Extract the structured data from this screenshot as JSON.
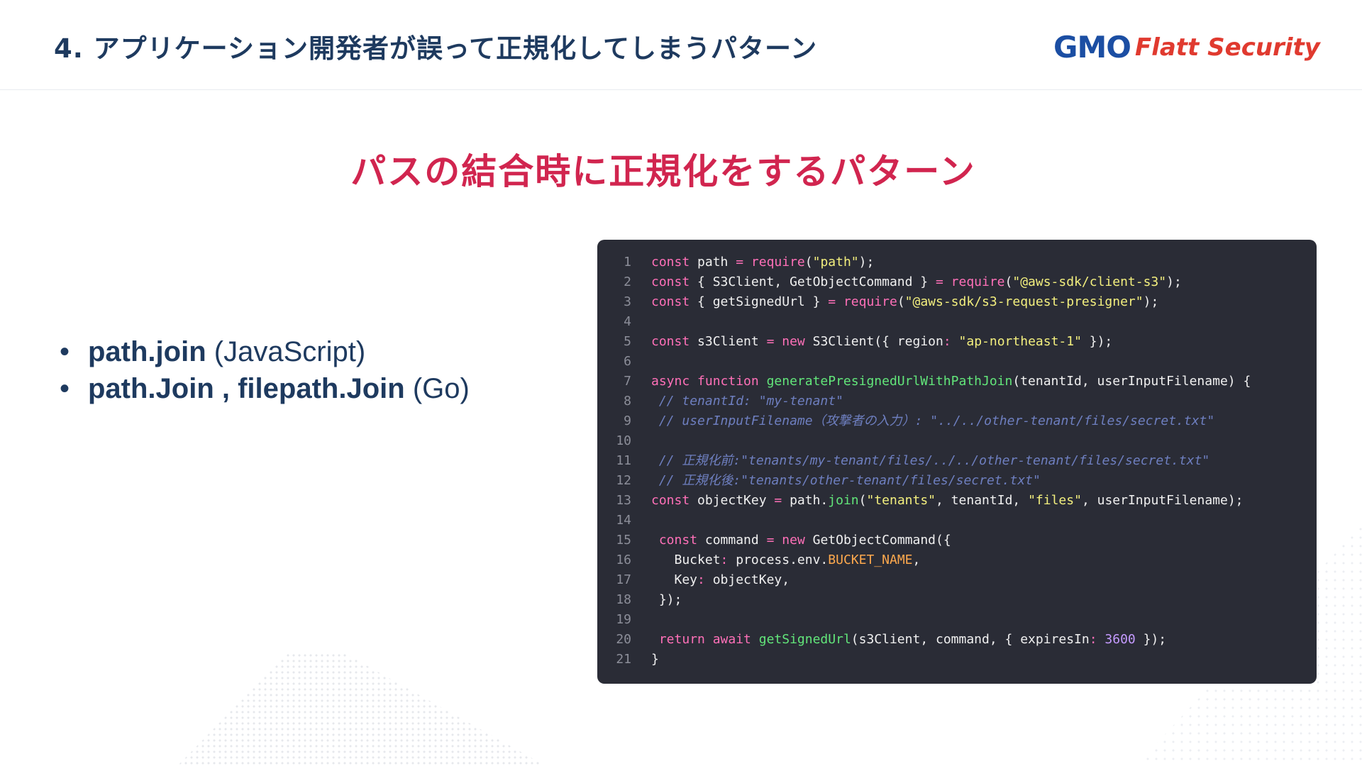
{
  "header": {
    "title": "4. アプリケーション開発者が誤って正規化してしまうパターン",
    "logo_gmo": "GMO",
    "logo_flatt": "Flatt Security"
  },
  "slide": {
    "title": "パスの結合時に正規化をするパターン",
    "bullets": [
      {
        "strong": "path.join",
        "paren": "(JavaScript)"
      },
      {
        "strong": "path.Join , filepath.Join",
        "paren": "(Go)"
      }
    ]
  },
  "code": {
    "line_numbers": [
      "1",
      "2",
      "3",
      "4",
      "5",
      "6",
      "7",
      "8",
      "9",
      "10",
      "11",
      "12",
      "13",
      "14",
      "15",
      "16",
      "17",
      "18",
      "19",
      "20",
      "21"
    ],
    "lines": [
      [
        [
          "k",
          "const"
        ],
        [
          "p",
          " path "
        ],
        [
          "k",
          "="
        ],
        [
          "p",
          " "
        ],
        [
          "k",
          "require"
        ],
        [
          "p",
          "("
        ],
        [
          "s",
          "\"path\""
        ],
        [
          "p",
          ");"
        ]
      ],
      [
        [
          "k",
          "const"
        ],
        [
          "p",
          " { S3Client, GetObjectCommand } "
        ],
        [
          "k",
          "="
        ],
        [
          "p",
          " "
        ],
        [
          "k",
          "require"
        ],
        [
          "p",
          "("
        ],
        [
          "s",
          "\"@aws-sdk/client-s3\""
        ],
        [
          "p",
          ");"
        ]
      ],
      [
        [
          "k",
          "const"
        ],
        [
          "p",
          " { getSignedUrl } "
        ],
        [
          "k",
          "="
        ],
        [
          "p",
          " "
        ],
        [
          "k",
          "require"
        ],
        [
          "p",
          "("
        ],
        [
          "s",
          "\"@aws-sdk/s3-request-presigner\""
        ],
        [
          "p",
          ");"
        ]
      ],
      [],
      [
        [
          "k",
          "const"
        ],
        [
          "p",
          " s3Client "
        ],
        [
          "k",
          "="
        ],
        [
          "p",
          " "
        ],
        [
          "k",
          "new"
        ],
        [
          "p",
          " S3Client({ region"
        ],
        [
          "k",
          ":"
        ],
        [
          "p",
          " "
        ],
        [
          "s",
          "\"ap-northeast-1\""
        ],
        [
          "p",
          " });"
        ]
      ],
      [],
      [
        [
          "k",
          "async function"
        ],
        [
          "p",
          " "
        ],
        [
          "f",
          "generatePresignedUrlWithPathJoin"
        ],
        [
          "p",
          "(tenantId, userInputFilename) {"
        ]
      ],
      [
        [
          "p",
          " "
        ],
        [
          "c",
          "// tenantId: \"my-tenant\""
        ]
      ],
      [
        [
          "p",
          " "
        ],
        [
          "c",
          "// userInputFilename（攻撃者の入力）: \"../../other-tenant/files/secret.txt\""
        ]
      ],
      [],
      [
        [
          "p",
          " "
        ],
        [
          "c",
          "// 正規化前:\"tenants/my-tenant/files/../../other-tenant/files/secret.txt\""
        ]
      ],
      [
        [
          "p",
          " "
        ],
        [
          "c",
          "// 正規化後:\"tenants/other-tenant/files/secret.txt\""
        ]
      ],
      [
        [
          "k",
          "const"
        ],
        [
          "p",
          " objectKey "
        ],
        [
          "k",
          "="
        ],
        [
          "p",
          " path."
        ],
        [
          "f",
          "join"
        ],
        [
          "p",
          "("
        ],
        [
          "s",
          "\"tenants\""
        ],
        [
          "p",
          ", tenantId, "
        ],
        [
          "s",
          "\"files\""
        ],
        [
          "p",
          ", userInputFilename);"
        ]
      ],
      [],
      [
        [
          "p",
          " "
        ],
        [
          "k",
          "const"
        ],
        [
          "p",
          " command "
        ],
        [
          "k",
          "="
        ],
        [
          "p",
          " "
        ],
        [
          "k",
          "new"
        ],
        [
          "p",
          " GetObjectCommand({"
        ]
      ],
      [
        [
          "p",
          "   Bucket"
        ],
        [
          "k",
          ":"
        ],
        [
          "p",
          " process.env."
        ],
        [
          "o",
          "BUCKET_NAME"
        ],
        [
          "p",
          ","
        ]
      ],
      [
        [
          "p",
          "   Key"
        ],
        [
          "k",
          ":"
        ],
        [
          "p",
          " objectKey,"
        ]
      ],
      [
        [
          "p",
          " });"
        ]
      ],
      [],
      [
        [
          "p",
          " "
        ],
        [
          "k",
          "return await"
        ],
        [
          "p",
          " "
        ],
        [
          "f",
          "getSignedUrl"
        ],
        [
          "p",
          "(s3Client, command, { expiresIn"
        ],
        [
          "k",
          ":"
        ],
        [
          "p",
          " "
        ],
        [
          "n",
          "3600"
        ],
        [
          "p",
          " });"
        ]
      ],
      [
        [
          "p",
          "}"
        ]
      ]
    ]
  }
}
